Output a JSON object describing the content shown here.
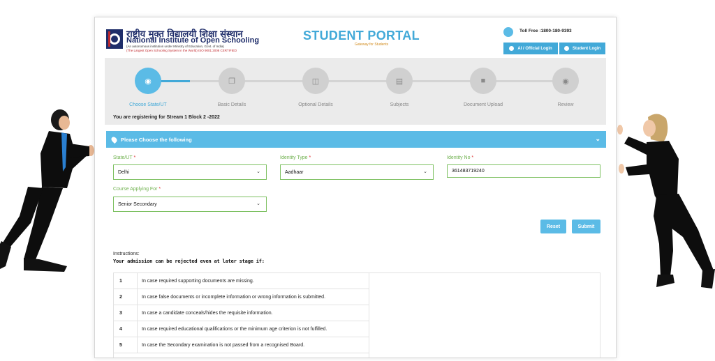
{
  "header": {
    "logo_hindi": "राष्ट्रीय मुक्त विद्यालयी शिक्षा संस्थान",
    "logo_english_prefix": "National Institute of ",
    "logo_english_bold": "Open Schooling",
    "logo_sub1": "(An autonomous institution under Ministry of Education, Govt. of India)",
    "logo_sub2": "(The Largest Open Schooling System in the World)   ISO 9001:2008 CERTIFIED",
    "portal_title": "STUDENT PORTAL",
    "portal_subtitle": "Gateway for Students",
    "toll_free": "Toll Free :1800-180-9393",
    "ai_login": "AI / Official Login",
    "student_login": "Student Login"
  },
  "steps": [
    {
      "label": "Choose State/UT",
      "icon": "map-pin-icon",
      "active": true
    },
    {
      "label": "Basic Details",
      "icon": "copy-icon",
      "active": false
    },
    {
      "label": "Optional Details",
      "icon": "columns-icon",
      "active": false
    },
    {
      "label": "Subjects",
      "icon": "book-icon",
      "active": false
    },
    {
      "label": "Document Upload",
      "icon": "file-icon",
      "active": false
    },
    {
      "label": "Review",
      "icon": "eye-icon",
      "active": false
    }
  ],
  "register_note": "You are registering for Stream 1 Block 2 -2022",
  "panel_title": "Please Choose the following",
  "form": {
    "state_label": "State/UT",
    "state_value": "Delhi",
    "identity_type_label": "Identity Type",
    "identity_type_value": "Aadhaar",
    "identity_no_label": "Identity No",
    "identity_no_value": "361483719240",
    "course_label": "Course Applying For",
    "course_value": "Senior Secondary",
    "required_mark": "*",
    "reset_label": "Reset",
    "submit_label": "Submit"
  },
  "instructions": {
    "heading": "Instructions:",
    "subheading": "Your admission can be rejected even at later stage if:",
    "rows": [
      {
        "num": "1",
        "text": "In case required supporting documents are missing."
      },
      {
        "num": "2",
        "text": "In case false documents or incomplete information or wrong information is submitted."
      },
      {
        "num": "3",
        "text": "In case a candidate conceals/hides the requisite information."
      },
      {
        "num": "4",
        "text": "In case required educational qualifications or the minimum age criterion is not fulfilled."
      },
      {
        "num": "5",
        "text": "In case the Secondary examination is not passed from a recognised Board."
      }
    ]
  },
  "colors": {
    "accent": "#5bbbe6",
    "field_border": "#7cc060",
    "label_green": "#6fb14e",
    "brand_navy": "#1f2d6a"
  }
}
